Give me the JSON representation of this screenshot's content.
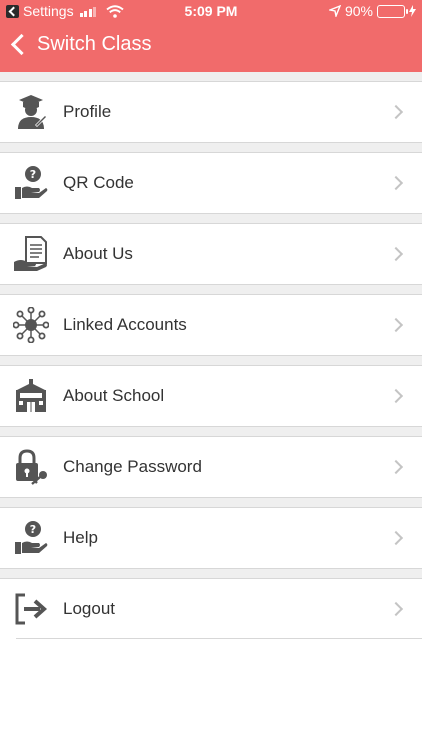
{
  "status_bar": {
    "back_app_label": "Settings",
    "time": "5:09 PM",
    "battery_percent": "90%",
    "battery_level": 0.9
  },
  "nav": {
    "title": "Switch Class"
  },
  "menu": {
    "items": [
      {
        "label": "Profile",
        "icon": "graduate-user-icon"
      },
      {
        "label": "QR Code",
        "icon": "hand-question-icon"
      },
      {
        "label": "About Us",
        "icon": "hand-document-icon"
      },
      {
        "label": "Linked Accounts",
        "icon": "network-nodes-icon"
      },
      {
        "label": "About School",
        "icon": "school-building-icon"
      },
      {
        "label": "Change Password",
        "icon": "lock-key-icon"
      },
      {
        "label": "Help",
        "icon": "hand-question-icon"
      },
      {
        "label": "Logout",
        "icon": "logout-arrow-icon"
      }
    ]
  },
  "colors": {
    "header": "#f16b6b",
    "battery": "#5ee05e",
    "icon": "#555555"
  }
}
